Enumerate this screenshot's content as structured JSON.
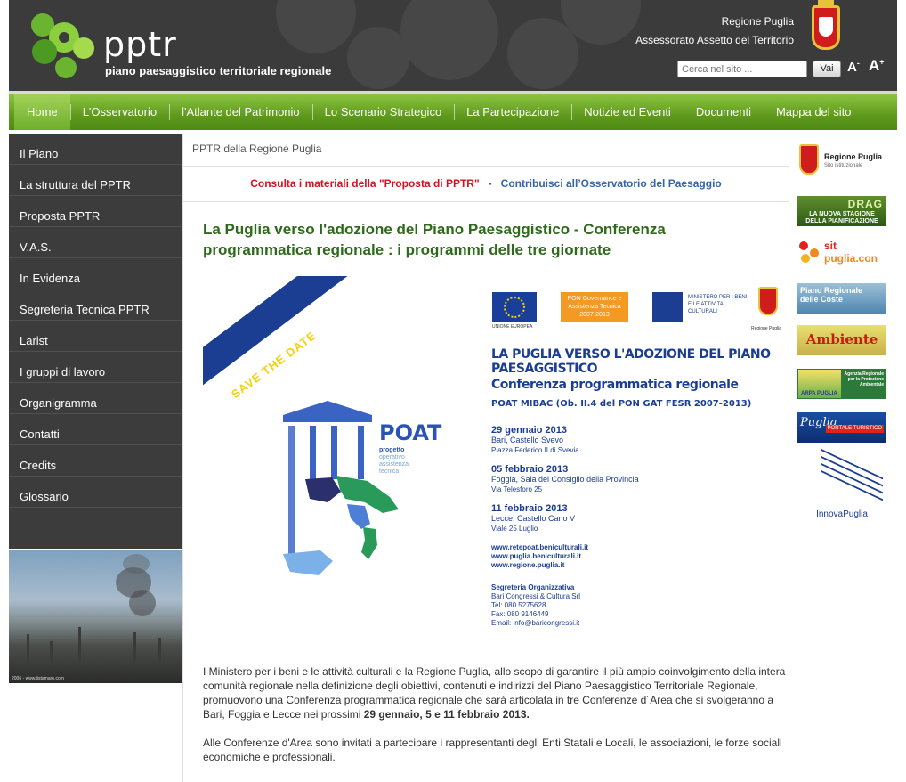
{
  "header": {
    "logo_brand": "pptr",
    "logo_subtitle": "piano paesaggistico territoriale regionale",
    "region_name": "Regione Puglia",
    "department": "Assessorato Assetto del Territorio",
    "search_placeholder": "Cerca nel sito ...",
    "search_button": "Vai",
    "font_small": "A",
    "font_small_sign": "-",
    "font_large": "A",
    "font_large_sign": "+"
  },
  "nav": {
    "items": [
      {
        "label": "Home"
      },
      {
        "label": "L'Osservatorio"
      },
      {
        "label": "l'Atlante del Patrimonio"
      },
      {
        "label": "Lo Scenario Strategico"
      },
      {
        "label": "La Partecipazione"
      },
      {
        "label": "Notizie ed Eventi"
      },
      {
        "label": "Documenti"
      },
      {
        "label": "Mappa del sito"
      }
    ],
    "active_index": 0
  },
  "sidebar": {
    "items": [
      {
        "label": "Il Piano"
      },
      {
        "label": "La struttura del PPTR"
      },
      {
        "label": "Proposta PPTR"
      },
      {
        "label": "V.A.S."
      },
      {
        "label": "In Evidenza"
      },
      {
        "label": "Segreteria Tecnica PPTR"
      },
      {
        "label": "Larist"
      },
      {
        "label": "I gruppi di lavoro"
      },
      {
        "label": "Organigramma"
      },
      {
        "label": "Contatti"
      },
      {
        "label": "Credits"
      },
      {
        "label": "Glossario"
      }
    ],
    "photo_credit": "2006 - www.tistamaro.com"
  },
  "main": {
    "breadcrumb": "PPTR della Regione Puglia",
    "link_proposta": "Consulta i materiali della \"Proposta di PPTR\"",
    "link_separator": "-",
    "link_osservatorio": "Contribuisci all’Osservatorio del Paesaggio",
    "article_title": "La Puglia verso l'adozione del Piano Paesaggistico - Conferenza programmatica regionale : i programmi delle tre giornate",
    "poster": {
      "ribbon": "SAVE THE DATE",
      "eu_caption": "UNIONE EUROPEA",
      "pon_text": "PON Governance e Assistenza Tecnica 2007-2013",
      "mibac_text": "MINISTERO PER I BENI E LE ATTIVITA' CULTURALI",
      "puglia_caption": "Regione Puglia",
      "title_line1": "LA PUGLIA VERSO L'ADOZIONE DEL PIANO PAESAGGISTICO",
      "title_line2": "Conferenza programmatica regionale",
      "title_line3": "POAT MIBAC (Ob. II.4 del PON GAT FESR 2007-2013)",
      "poat_word": "POAT",
      "poat_tag1": "progetto",
      "poat_tag2": "operativo",
      "poat_tag3": "assistenza",
      "poat_tag4": "tecnica",
      "events": [
        {
          "date": "29 gennaio 2013",
          "place": "Bari, Castello Svevo",
          "detail": "Piazza Federico II di Svevia"
        },
        {
          "date": "05 febbraio 2013",
          "place": "Foggia, Sala del Consiglio della Provincia",
          "detail": "Via Telesforo 25"
        },
        {
          "date": "11 febbraio 2013",
          "place": "Lecce, Castello Carlo V",
          "detail": "Viale 25 Luglio"
        }
      ],
      "links": [
        "www.retepoat.beniculturali.it",
        "www.puglia.beniculturali.it",
        "www.regione.puglia.it"
      ],
      "secretariat_heading": "Segreteria Organizzativa",
      "secretariat_lines": [
        "Bari Congressi & Cultura Srl",
        "Tel: 080 5275628",
        "Fax: 080 9146449",
        "Email: info@baricongressi.it"
      ]
    },
    "paragraph1_text": "I Ministero per i beni e le attività culturali e la Regione Puglia, allo scopo di garantire il più ampio coinvolgimento della intera comunità regionale nella definizione degli obiettivi, contenuti e indirizzi del Piano Paesaggistico Territoriale Regionale, promuovono una Conferenza programmatica regionale che sarà articolata in tre Conferenze d´Area che si svolgeranno a Bari, Foggia e Lecce nei prossimi ",
    "paragraph1_bold": "29 gennaio, 5 e 11 febbraio 2013.",
    "paragraph2": "Alle Conferenze d'Area sono invitati a partecipare i rappresentanti degli Enti Statali e Locali, le associazioni, le forze sociali economiche e professionali."
  },
  "right_banners": {
    "regione_name": "Regione Puglia",
    "regione_sub": "Sito istituzionale",
    "drag_title": "DRAG",
    "drag_sub": "LA NUOVA STAGIONE DELLA PIANIFICAZIONE",
    "sit_line1": "sit",
    "sit_line2": "puglia.con",
    "coste_line1": "Piano Regionale",
    "coste_line2": "delle Coste",
    "ambiente": "Ambiente",
    "arpa_left": "ARPA PUGLIA",
    "arpa_right": "Agenzia Regionale per la Protezione Ambientale",
    "turismo_logo": "Puglia",
    "turismo_tag": "PORTALE TURISTICO",
    "innova": "InnovaPuglia"
  },
  "colors": {
    "header_bg": "#3b3b3b",
    "nav_green": "#5f9a1e",
    "sidebar_bg": "#3c3c3c",
    "title_green": "#2f6a1c",
    "link_red": "#d3141f",
    "link_blue": "#3565a8"
  }
}
